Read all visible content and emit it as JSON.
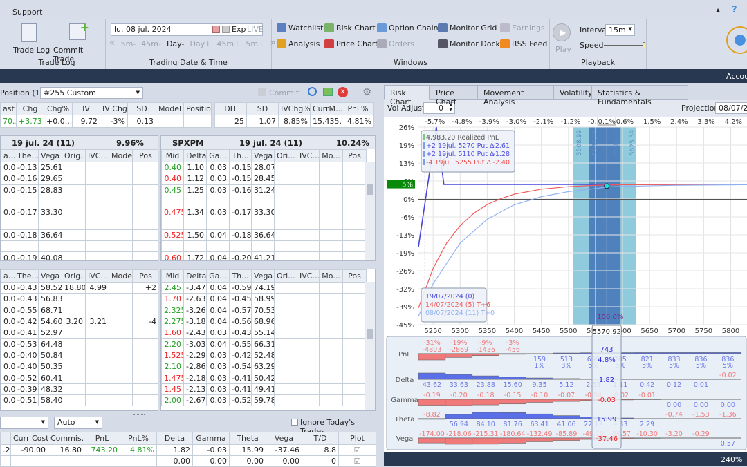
{
  "menu": {
    "support": "Support",
    "collapse_icon": "caret-up-icon",
    "help_icon": "help-icon"
  },
  "ribbon": {
    "trade_log": {
      "trade_log": "Trade Log",
      "commit_trade": "Commit Trade",
      "group": "Trade Log"
    },
    "trading_date": {
      "date": "lu. 08 jul. 2024",
      "exp": "Exp",
      "live": "LIVE",
      "nav": [
        "5m-",
        "45m-",
        "Day-",
        "Day+",
        "45m+",
        "5m+"
      ],
      "group": "Trading Date & Time"
    },
    "windows": {
      "group": "Windows",
      "items": [
        {
          "label": "Watchlist",
          "icon": "list-icon",
          "enabled": true
        },
        {
          "label": "Analysis",
          "icon": "sigma-icon",
          "enabled": true
        },
        {
          "label": "Risk Chart",
          "icon": "risk-chart-icon",
          "enabled": true
        },
        {
          "label": "Price Chart",
          "icon": "price-chart-icon",
          "enabled": true
        },
        {
          "label": "Option Chain",
          "icon": "grid-icon",
          "enabled": true
        },
        {
          "label": "Orders",
          "icon": "orders-icon",
          "enabled": false
        },
        {
          "label": "Monitor Grid",
          "icon": "monitor-icon",
          "enabled": true
        },
        {
          "label": "Monitor Dock",
          "icon": "eye-icon",
          "enabled": true
        },
        {
          "label": "Earnings",
          "icon": "calendar-icon",
          "enabled": false
        },
        {
          "label": "RSS Feed",
          "icon": "rss-icon",
          "enabled": true
        }
      ]
    },
    "playback": {
      "play": "Play",
      "interval_label": "Interval",
      "interval": "15m",
      "speed_label": "Speed",
      "speed_level": 1.0,
      "group": "Playback"
    }
  },
  "header_bar": {
    "account": "Accou"
  },
  "position": {
    "label": "Position (1)",
    "selected": "#255 Custom",
    "commit": "Commit"
  },
  "summary": {
    "headers": [
      "ast",
      "Chg",
      "Chg%",
      "IV",
      "IV Chg",
      "SD",
      "Model",
      "Position"
    ],
    "values": [
      "70....",
      "+3.73",
      "+0.0...",
      "9.72",
      "-3%",
      "0.13",
      "",
      ""
    ],
    "headers2": [
      "DIT",
      "SD",
      "IVChg%",
      "CurrM...",
      "PnL%"
    ],
    "values2": [
      "25",
      "1.07",
      "8.85%",
      "15,435...",
      "4.81%"
    ]
  },
  "chain_upper": {
    "left_title": "19 jul. 24 (11)",
    "left_iv": "9.96%",
    "right_symbol": "SPXPM",
    "right_title": "19 jul. 24 (11)",
    "right_iv": "10.24%",
    "left_headers": [
      "a...",
      "The...",
      "Vega",
      "Orig...",
      "IVC...",
      "Model",
      "Pos"
    ],
    "right_headers": [
      "Mid",
      "Delta",
      "Ga...",
      "Th...",
      "Vega",
      "Ori...",
      "IVC...",
      "Mo...",
      "Pos"
    ],
    "left_rows": [
      [
        "0.03",
        "-0.13",
        "25.61",
        "",
        "",
        "",
        ""
      ],
      [
        "0.03",
        "-0.16",
        "29.65",
        "",
        "",
        "",
        ""
      ],
      [
        "0.03",
        "-0.15",
        "28.83",
        "",
        "",
        "",
        ""
      ],
      [
        "",
        "",
        "",
        "",
        "",
        "",
        ""
      ],
      [
        "0.03",
        "-0.17",
        "33.30",
        "",
        "",
        "",
        ""
      ],
      [
        "",
        "",
        "",
        "",
        "",
        "",
        ""
      ],
      [
        "0.04",
        "-0.18",
        "36.64",
        "",
        "",
        "",
        ""
      ],
      [
        "",
        "",
        "",
        "",
        "",
        "",
        ""
      ],
      [
        "0.04",
        "-0.19",
        "40.08",
        "",
        "",
        "",
        ""
      ]
    ],
    "right_rows": [
      [
        "0.40",
        "1.10",
        "0.03",
        "-0.15",
        "28.07",
        "",
        "",
        "",
        ""
      ],
      [
        "0.40",
        "1.12",
        "0.03",
        "-0.15",
        "28.45",
        "",
        "",
        "",
        ""
      ],
      [
        "0.45",
        "1.25",
        "0.03",
        "-0.16",
        "31.24",
        "",
        "",
        "",
        ""
      ],
      [
        "",
        "",
        "",
        "",
        "",
        "",
        "",
        "",
        ""
      ],
      [
        "0.475",
        "1.34",
        "0.03",
        "-0.17",
        "33.30",
        "",
        "",
        "",
        ""
      ],
      [
        "",
        "",
        "",
        "",
        "",
        "",
        "",
        "",
        ""
      ],
      [
        "0.525",
        "1.50",
        "0.04",
        "-0.18",
        "36.64",
        "",
        "",
        "",
        ""
      ],
      [
        "",
        "",
        "",
        "",
        "",
        "",
        "",
        "",
        ""
      ],
      [
        "0.60",
        "1.72",
        "0.04",
        "-0.20",
        "41.21",
        "",
        "",
        "",
        ""
      ]
    ],
    "mid_dir": [
      "up",
      "dn",
      "up",
      "",
      "dn",
      "",
      "dn",
      "",
      "dn"
    ]
  },
  "chain_lower": {
    "left_headers": [
      "a...",
      "The...",
      "Vega",
      "Orig...",
      "IVC...",
      "Model",
      "Pos"
    ],
    "right_headers": [
      "Mid",
      "Delta",
      "Ga...",
      "Th...",
      "Vega",
      "Ori...",
      "IVC...",
      "Mo...",
      "Pos"
    ],
    "left_rows": [
      [
        "0.04",
        "-0.43",
        "58.52",
        "18.80",
        "4.99",
        "",
        "+2"
      ],
      [
        "0.04",
        "-0.43",
        "56.83",
        "",
        "",
        "",
        ""
      ],
      [
        "0.04",
        "-0.55",
        "68.71",
        "",
        "",
        "",
        ""
      ],
      [
        "0.03",
        "-0.42",
        "54.60",
        "3.20",
        "3.21",
        "",
        "-4"
      ],
      [
        "0.03",
        "-0.41",
        "52.97",
        "",
        "",
        "",
        ""
      ],
      [
        "0.04",
        "-0.53",
        "64.48",
        "",
        "",
        "",
        ""
      ],
      [
        "0.03",
        "-0.40",
        "50.84",
        "",
        "",
        "",
        ""
      ],
      [
        "0.03",
        "-0.40",
        "50.35",
        "",
        "",
        "",
        ""
      ],
      [
        "0.03",
        "-0.52",
        "60.41",
        "",
        "",
        "",
        ""
      ],
      [
        "0.03",
        "-0.39",
        "48.32",
        "",
        "",
        "",
        ""
      ],
      [
        "0.03",
        "-0.51",
        "58.40",
        "",
        "",
        "",
        ""
      ]
    ],
    "right_rows": [
      [
        "2.45",
        "-3.47",
        "0.04",
        "-0.59",
        "74.19",
        "",
        "",
        "",
        ""
      ],
      [
        "1.70",
        "-2.63",
        "0.04",
        "-0.45",
        "58.99",
        "",
        "",
        "",
        ""
      ],
      [
        "2.325",
        "-3.26",
        "0.04",
        "-0.57",
        "70.53",
        "",
        "",
        "",
        ""
      ],
      [
        "2.275",
        "-3.18",
        "0.04",
        "-0.56",
        "68.96",
        "",
        "",
        "",
        ""
      ],
      [
        "1.60",
        "-2.43",
        "0.03",
        "-0.43",
        "55.14",
        "",
        "",
        "",
        ""
      ],
      [
        "2.20",
        "-3.03",
        "0.04",
        "-0.55",
        "66.31",
        "",
        "",
        "",
        ""
      ],
      [
        "1.525",
        "-2.29",
        "0.03",
        "-0.42",
        "52.48",
        "",
        "",
        "",
        ""
      ],
      [
        "2.10",
        "-2.86",
        "0.03",
        "-0.54",
        "63.29",
        "",
        "",
        "",
        ""
      ],
      [
        "1.475",
        "-2.18",
        "0.03",
        "-0.41",
        "50.42",
        "",
        "",
        "",
        ""
      ],
      [
        "1.45",
        "-2.13",
        "0.03",
        "-0.41",
        "49.41",
        "",
        "",
        "",
        ""
      ],
      [
        "2.00",
        "-2.67",
        "0.03",
        "-0.52",
        "59.78",
        "",
        "",
        "",
        ""
      ]
    ],
    "mid_dir": [
      "up",
      "dn",
      "up",
      "up",
      "dn",
      "up",
      "dn",
      "up",
      "dn",
      "dn",
      "up"
    ]
  },
  "bottom": {
    "select1": "",
    "select2": "Auto",
    "ignore_label": "Ignore Today's Trades",
    "ignore_checked": false,
    "headers": [
      "",
      "Curr Cost",
      "Commis...",
      "PnL",
      "PnL%",
      "Delta",
      "Gamma",
      "Theta",
      "Vega",
      "T/D",
      "Plot"
    ],
    "rows": [
      [
        ".20",
        "-90.00",
        "16.80",
        "743.20",
        "4.81%",
        "1.82",
        "-0.03",
        "15.99",
        "-37.46",
        "8.8",
        true
      ],
      [
        "",
        "",
        "",
        "",
        "",
        "0.00",
        "0.00",
        "0.00",
        "0.00",
        "0",
        true
      ]
    ]
  },
  "right_tabs": [
    "Risk Chart",
    "Price Chart",
    "Movement Analysis",
    "Volatility",
    "Statistics & Fundamentals"
  ],
  "active_tab": 0,
  "vol_adjust": {
    "label": "Vol Adjust",
    "value": "0"
  },
  "projection": {
    "label": "Projection",
    "value": "08/07/20"
  },
  "risk_chart": {
    "x_range": [
      5223,
      5830
    ],
    "y_range": [
      -45,
      26
    ],
    "x_ticks": [
      5250,
      5300,
      5350,
      5400,
      5450,
      5500,
      5550,
      5600,
      5650,
      5700,
      5750,
      5800
    ],
    "y_ticks": [
      "26%",
      "19%",
      "13%",
      "6%",
      "0%",
      "-6%",
      "-13%",
      "-19%",
      "-26%",
      "-32%",
      "-39%",
      "-45%"
    ],
    "pct_ticks": [
      "-5.7%",
      "-4.8%",
      "-3.9%",
      "-3.0%",
      "-2.1%",
      "-1.2%",
      "-0.3%",
      "0.6%",
      "1.5%",
      "2.4%",
      "3.3%",
      "4.2%"
    ],
    "current_price": "5570.92",
    "current_price_value": 5570.92,
    "current_pct": "0.1%",
    "current_pnl_pct": 4.8,
    "pnl_label": "5%",
    "prob_label": "100.0%",
    "sd_bands": [
      {
        "low": 5508.99,
        "high": 5625.39,
        "low_label": "5508.99",
        "high_label": "5625.39",
        "color": "#8fcbdc"
      },
      {
        "low": 5538.09,
        "high": 5596.29,
        "low_label": "5538.09",
        "high_label": "5596.29",
        "color": "#4f81bd"
      }
    ],
    "marker_x": 5235,
    "legend": [
      {
        "text": "4,983.20 Realized PnL",
        "delta": "",
        "color": "#555555"
      },
      {
        "text": "+2 19jul. 5270 Put Δ",
        "delta": "-2.61",
        "color": "#5050e0"
      },
      {
        "text": "+2 19jul. 5110 Put Δ",
        "delta": "-1.28",
        "color": "#5050e0"
      },
      {
        "text": "-4 19jul. 5255 Put Δ",
        "delta": "-2.40",
        "color": "#f05050"
      }
    ],
    "series": [
      {
        "name": "19/07/2024 (0)",
        "color": "#4646d8",
        "points": [
          [
            5223,
            -17
          ],
          [
            5236,
            0
          ],
          [
            5256,
            26
          ],
          [
            5270,
            5.4
          ],
          [
            5830,
            5.4
          ]
        ]
      },
      {
        "name": "14/07/2024 (5) T+6",
        "color": "#f05a5a",
        "points": [
          [
            5223,
            -39
          ],
          [
            5250,
            -24.8
          ],
          [
            5275,
            -15.7
          ],
          [
            5300,
            -9.4
          ],
          [
            5325,
            -5.0
          ],
          [
            5350,
            -1.8
          ],
          [
            5375,
            0.3
          ],
          [
            5400,
            1.9
          ],
          [
            5450,
            3.7
          ],
          [
            5500,
            4.6
          ],
          [
            5550,
            5.1
          ],
          [
            5600,
            5.3
          ],
          [
            5830,
            5.4
          ]
        ]
      },
      {
        "name": "08/07/2024 (11) T+0",
        "color": "#8fb0f0",
        "points": [
          [
            5223,
            -42
          ],
          [
            5250,
            -30.3
          ],
          [
            5300,
            -15.7
          ],
          [
            5350,
            -7.1
          ],
          [
            5400,
            -1.9
          ],
          [
            5450,
            1.0
          ],
          [
            5500,
            2.8
          ],
          [
            5550,
            3.9
          ],
          [
            5570.92,
            4.5
          ],
          [
            5600,
            4.7
          ],
          [
            5700,
            5.1
          ],
          [
            5830,
            5.3
          ]
        ]
      }
    ]
  },
  "greeks": {
    "rows": [
      {
        "label": "PnL",
        "values": [
          "-4803",
          "-2869",
          "-1436",
          "-456",
          "159",
          "513",
          "698",
          "785",
          "821",
          "833",
          "836",
          "836"
        ],
        "pct": [
          "-31%",
          "-19%",
          "-9%",
          "-3%",
          "1%",
          "3%",
          "5%",
          "5%",
          "5%",
          "5%",
          "5%",
          "5%"
        ],
        "current": "743",
        "current_pct": "4.8%"
      },
      {
        "label": "Delta",
        "values": [
          "43.62",
          "33.63",
          "23.88",
          "15.60",
          "9.35",
          "5.12",
          "2.53",
          "1.11",
          "0.42",
          "0.12",
          "0.01",
          "-0.02"
        ],
        "current": "1.82"
      },
      {
        "label": "Gamma",
        "values": [
          "-0.19",
          "-0.20",
          "-0.18",
          "-0.15",
          "-0.10",
          "-0.07",
          "-0.04",
          "-0.02",
          "-0.01",
          "0.00",
          "0.00",
          "0.00"
        ],
        "current": "-0.03"
      },
      {
        "label": "Theta",
        "values": [
          "-8.82",
          "56.94",
          "84.10",
          "81.76",
          "63.41",
          "41.06",
          "22.12",
          "9.33",
          "2.29",
          "-0.74",
          "-1.53",
          "-1.36"
        ],
        "current": "15.99"
      },
      {
        "label": "Vega",
        "values": [
          "-174.00",
          "-218.06",
          "-215.31",
          "-180.64",
          "-132.49",
          "-85.89",
          "-49.10",
          "-24.57",
          "-10.30",
          "-3.20",
          "-0.29",
          "0.57"
        ],
        "current": "-37.46"
      }
    ]
  },
  "status": {
    "zoom": "240%"
  },
  "colors": {
    "positive": "#22a022",
    "negative": "#ee2222",
    "bar_pos": "#5a6ee8",
    "bar_neg": "#f07a7a",
    "dark": "#283850"
  }
}
